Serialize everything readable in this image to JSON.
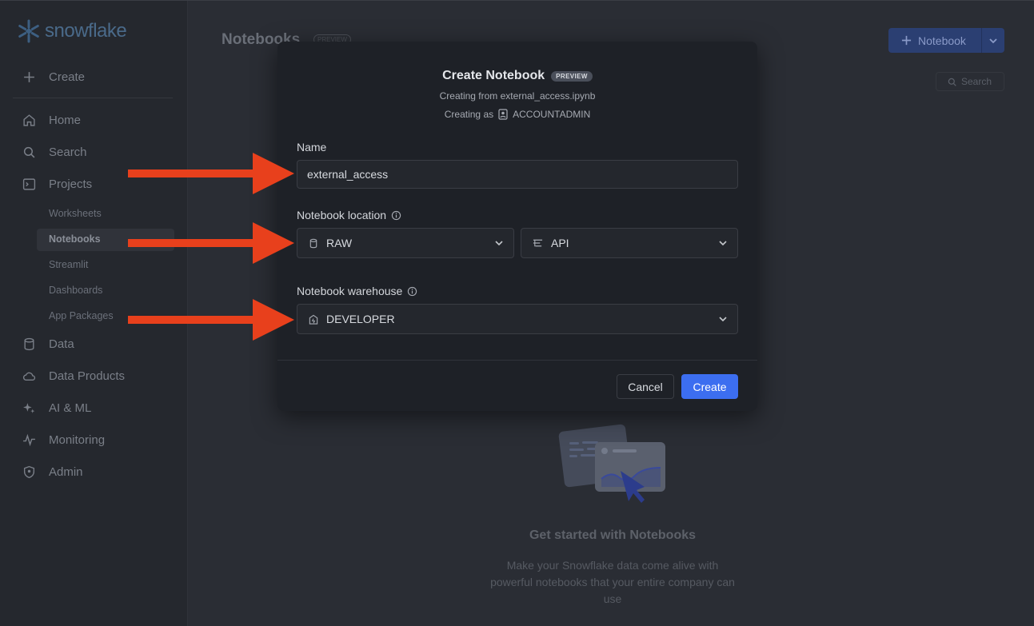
{
  "sidebar": {
    "logo_text": "snowflake",
    "create_label": "Create",
    "items": [
      {
        "label": "Home",
        "icon": "home-icon"
      },
      {
        "label": "Search",
        "icon": "search-icon"
      },
      {
        "label": "Projects",
        "icon": "terminal-icon"
      },
      {
        "label": "Data",
        "icon": "database-icon"
      },
      {
        "label": "Data Products",
        "icon": "cloud-icon"
      },
      {
        "label": "AI & ML",
        "icon": "sparkle-icon"
      },
      {
        "label": "Monitoring",
        "icon": "pulse-icon"
      },
      {
        "label": "Admin",
        "icon": "shield-icon"
      }
    ],
    "sub_items": [
      "Worksheets",
      "Notebooks",
      "Streamlit",
      "Dashboards",
      "App Packages"
    ]
  },
  "main": {
    "title": "Notebooks",
    "badge": "PREVIEW",
    "new_button_label": "Notebook",
    "search_placeholder": "Search",
    "empty_title": "Get started with Notebooks",
    "empty_desc": "Make your Snowflake data come alive with powerful notebooks that your entire company can use"
  },
  "modal": {
    "title": "Create Notebook",
    "badge": "PREVIEW",
    "subtitle": "Creating from external_access.ipynb",
    "creating_as_label": "Creating as",
    "role": "ACCOUNTADMIN",
    "name_label": "Name",
    "name_value": "external_access",
    "location_label": "Notebook location",
    "database_value": "RAW",
    "schema_value": "API",
    "warehouse_label": "Notebook warehouse",
    "warehouse_value": "DEVELOPER",
    "cancel_label": "Cancel",
    "create_label": "Create"
  },
  "colors": {
    "accent": "#3c6ef0",
    "arrow": "#e8401c",
    "modal_bg": "#1e2127"
  }
}
